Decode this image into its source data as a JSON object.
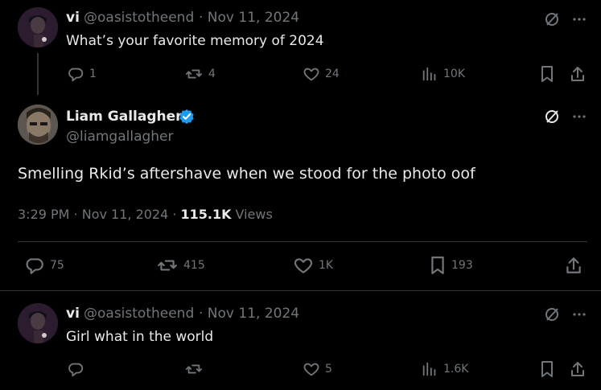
{
  "tweet1": {
    "name": "vi",
    "handle": "@oasistotheend",
    "date": "· Nov 11, 2024",
    "text": "What’s your favorite memory of 2024",
    "replies": "1",
    "reposts": "4",
    "likes": "24",
    "views": "10K"
  },
  "tweet2": {
    "name": "Liam Gallagher",
    "handle": "@liamgallagher",
    "text": "Smelling Rkid’s aftershave when we stood for the photo oof",
    "time": "3:29 PM · Nov 11, 2024 ·",
    "views_count": "115.1K",
    "views_label": "Views",
    "replies": "75",
    "reposts": "415",
    "likes": "1K",
    "bookmarks": "193"
  },
  "tweet3": {
    "name": "vi",
    "handle": "@oasistotheend",
    "date": "· Nov 11, 2024",
    "text": "Girl what in the world",
    "replies": "",
    "reposts": "",
    "likes": "5",
    "views": "1.6K"
  },
  "colors": {
    "background": "#000000",
    "text": "#e7e9ea",
    "muted": "#71767b",
    "verified": "#1d9bf0",
    "divider": "#2f3336"
  }
}
